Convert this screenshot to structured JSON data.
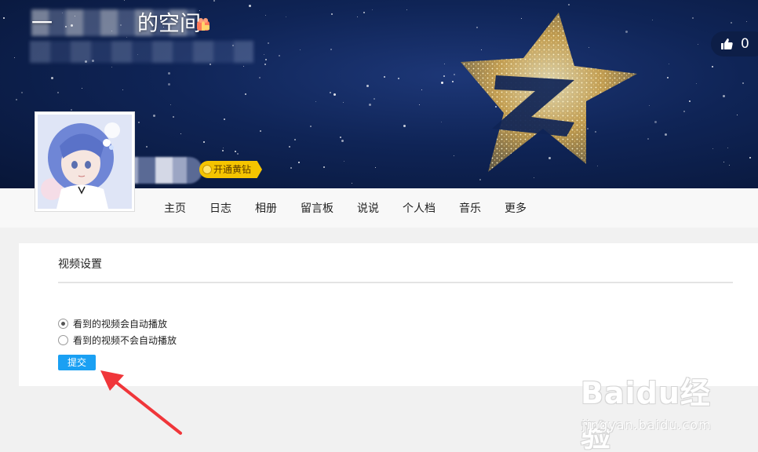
{
  "header": {
    "space_title": "一　　　　的空间",
    "likes_count": "0",
    "yellow_diamond_label": "开通黄钻"
  },
  "nav": {
    "items": [
      "主页",
      "日志",
      "相册",
      "留言板",
      "说说",
      "个人档",
      "音乐",
      "更多"
    ]
  },
  "settings": {
    "title": "视频设置",
    "options": [
      {
        "label": "看到的视频会自动播放",
        "checked": true
      },
      {
        "label": "看到的视频不会自动播放",
        "checked": false
      }
    ],
    "submit_label": "提交"
  },
  "watermark": {
    "logo_text": "Baidu经验",
    "url_text": "jingyan.baidu.com"
  },
  "colors": {
    "banner_bg": "#0f2456",
    "nav_bg": "#f8f8f8",
    "submit_bg": "#1aa0f3",
    "arrow": "#f0363a",
    "yellow_diamond": "#f5c400"
  },
  "icons": [
    "vip-gift-icon",
    "thumbs-up-icon",
    "yellow-diamond-icon",
    "annotation-arrow"
  ]
}
